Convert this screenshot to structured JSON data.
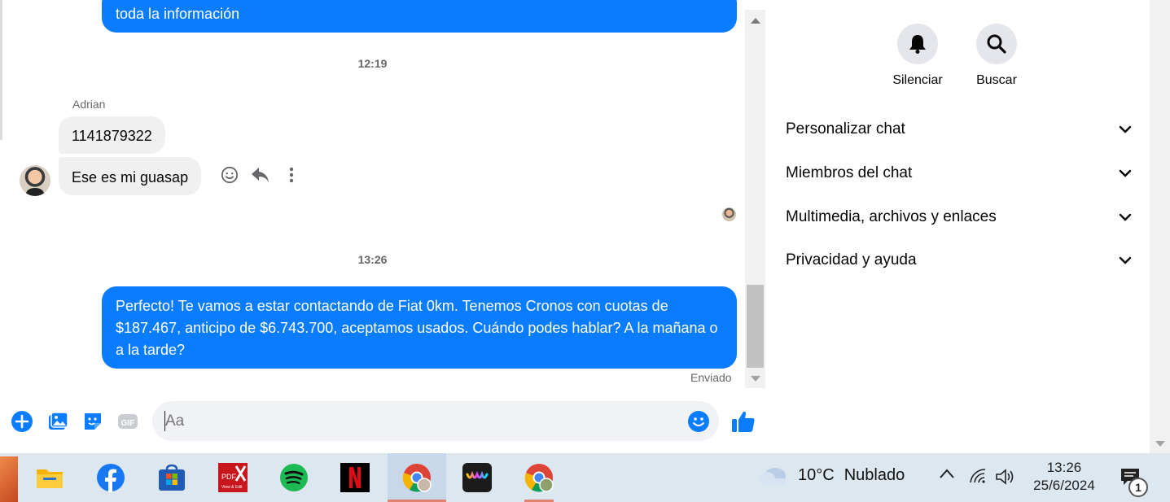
{
  "chat": {
    "prev_message_tail": "toda la información",
    "time_1": "12:19",
    "sender_name": "Adrian",
    "incoming_1": "1141879322",
    "incoming_2": "Ese es mi guasap",
    "time_2": "13:26",
    "outgoing_message": "Perfecto! Te vamos a estar contactando de Fiat 0km. Tenemos Cronos con cuotas de $187.467, anticipo de $6.743.700, aceptamos usados. Cuándo podes hablar? A la mañana o a la tarde?",
    "status": "Enviado"
  },
  "composer": {
    "placeholder": "Aa",
    "icons": [
      "plus-circle-icon",
      "image-icon",
      "sticker-icon",
      "gif-icon",
      "emoji-icon",
      "like-icon"
    ]
  },
  "details": {
    "tools": [
      {
        "label": "Silenciar",
        "icon": "bell-icon"
      },
      {
        "label": "Buscar",
        "icon": "search-icon"
      }
    ],
    "sections": [
      {
        "label": "Personalizar chat"
      },
      {
        "label": "Miembros del chat"
      },
      {
        "label": "Multimedia, archivos y enlaces"
      },
      {
        "label": "Privacidad y ayuda"
      }
    ]
  },
  "taskbar": {
    "apps": [
      "file-explorer",
      "facebook",
      "microsoft-store",
      "pdfx",
      "spotify",
      "netflix",
      "chrome",
      "app",
      "chrome-profile"
    ],
    "weather_temp": "10°C",
    "weather_text": "Nublado",
    "time": "13:26",
    "date": "25/6/2024",
    "notification_count": "1"
  },
  "colors": {
    "messenger_blue": "#0a7cff",
    "incoming_bubble": "#f0f0f0",
    "taskbar": "#dde7f0"
  }
}
